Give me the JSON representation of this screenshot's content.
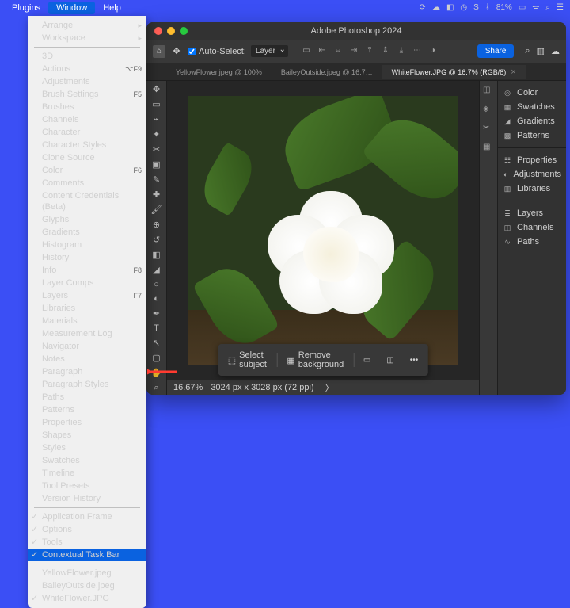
{
  "menubar": {
    "plugins": "Plugins",
    "window": "Window",
    "help": "Help"
  },
  "macstatus": {
    "battery": "81%"
  },
  "dropdown": {
    "arrange": "Arrange",
    "workspace": "Workspace",
    "items": [
      {
        "label": "3D"
      },
      {
        "label": "Actions",
        "shortcut": "⌥F9"
      },
      {
        "label": "Adjustments"
      },
      {
        "label": "Brush Settings",
        "shortcut": "F5"
      },
      {
        "label": "Brushes"
      },
      {
        "label": "Channels"
      },
      {
        "label": "Character"
      },
      {
        "label": "Character Styles"
      },
      {
        "label": "Clone Source"
      },
      {
        "label": "Color",
        "shortcut": "F6"
      },
      {
        "label": "Comments"
      },
      {
        "label": "Content Credentials (Beta)"
      },
      {
        "label": "Glyphs"
      },
      {
        "label": "Gradients"
      },
      {
        "label": "Histogram"
      },
      {
        "label": "History"
      },
      {
        "label": "Info",
        "shortcut": "F8"
      },
      {
        "label": "Layer Comps"
      },
      {
        "label": "Layers",
        "shortcut": "F7"
      },
      {
        "label": "Libraries"
      },
      {
        "label": "Materials"
      },
      {
        "label": "Measurement Log"
      },
      {
        "label": "Navigator"
      },
      {
        "label": "Notes"
      },
      {
        "label": "Paragraph"
      },
      {
        "label": "Paragraph Styles"
      },
      {
        "label": "Paths"
      },
      {
        "label": "Patterns"
      },
      {
        "label": "Properties"
      },
      {
        "label": "Shapes"
      },
      {
        "label": "Styles"
      },
      {
        "label": "Swatches"
      },
      {
        "label": "Timeline"
      },
      {
        "label": "Tool Presets"
      },
      {
        "label": "Version History"
      }
    ],
    "toggles": [
      {
        "label": "Application Frame",
        "checked": true
      },
      {
        "label": "Options",
        "checked": true
      },
      {
        "label": "Tools",
        "checked": true
      },
      {
        "label": "Contextual Task Bar",
        "checked": true,
        "highlight": true
      }
    ],
    "docs": [
      {
        "label": "YellowFlower.jpeg"
      },
      {
        "label": "BaileyOutside.jpeg"
      },
      {
        "label": "WhiteFlower.JPG",
        "checked": true
      }
    ]
  },
  "app": {
    "title": "Adobe Photoshop 2024",
    "optbar": {
      "autoselect": "Auto-Select:",
      "layer": "Layer",
      "share": "Share"
    },
    "tabs": [
      {
        "label": "YellowFlower.jpeg @ 100%"
      },
      {
        "label": "BaileyOutside.jpeg @ 16.7…"
      },
      {
        "label": "WhiteFlower.JPG @ 16.7% (RGB/8)",
        "active": true
      }
    ],
    "context": {
      "select": "Select subject",
      "remove": "Remove background",
      "more": "•••"
    },
    "status": {
      "zoom": "16.67%",
      "dims": "3024 px x 3028 px (72 ppi)"
    },
    "panels": {
      "color": "Color",
      "swatches": "Swatches",
      "gradients": "Gradients",
      "patterns": "Patterns",
      "properties": "Properties",
      "adjustments": "Adjustments",
      "libraries": "Libraries",
      "layers": "Layers",
      "channels": "Channels",
      "paths": "Paths"
    }
  }
}
